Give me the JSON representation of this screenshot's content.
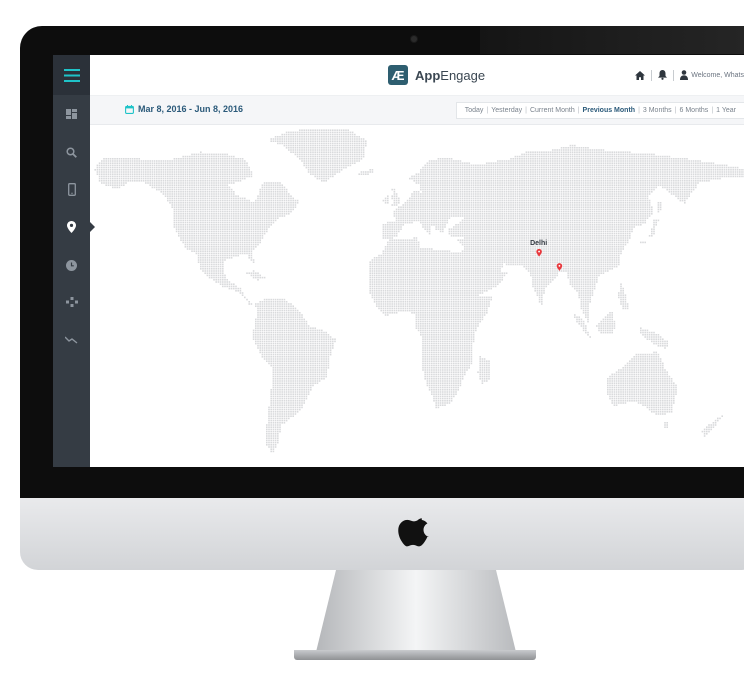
{
  "app": {
    "brand_initial": "Æ",
    "brand_bold": "App",
    "brand_light": "Engage"
  },
  "header": {
    "welcome_text": "Welcome, Whats"
  },
  "sidebar": {
    "items": [
      {
        "icon": "dashboard-icon"
      },
      {
        "icon": "search-icon"
      },
      {
        "icon": "mobile-icon"
      },
      {
        "icon": "location-pin-icon",
        "active": true
      },
      {
        "icon": "clock-icon"
      },
      {
        "icon": "gamepad-icon"
      },
      {
        "icon": "trend-down-icon"
      }
    ]
  },
  "filters": {
    "date_range": "Mar 8, 2016 - Jun 8, 2016",
    "quick_ranges": [
      "Today",
      "Yesterday",
      "Current Month",
      "Previous Month",
      "3 Months",
      "6 Months",
      "1 Year"
    ],
    "active_range": "Previous Month"
  },
  "map": {
    "markers": [
      {
        "label": "Delhi",
        "lat": 28.6,
        "lon": 77.2
      },
      {
        "label": "",
        "lat": 22.6,
        "lon": 88.4
      }
    ]
  },
  "colors": {
    "accent": "#1fc3c8",
    "sidebar": "#353c44",
    "marker": "#e8383d",
    "map_dots": "#d9dadc"
  }
}
